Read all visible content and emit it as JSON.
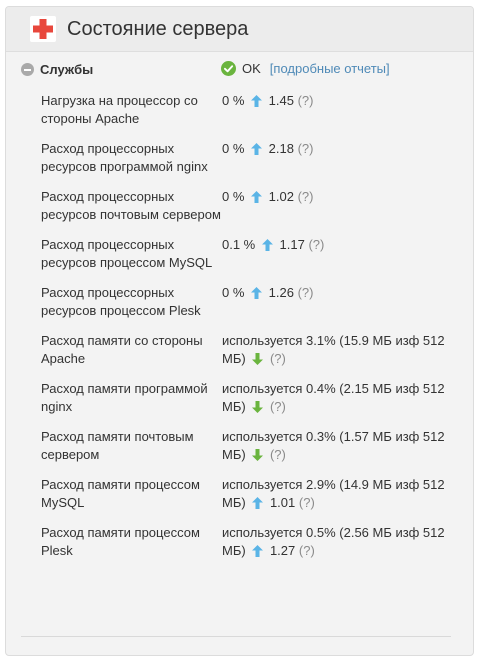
{
  "panel": {
    "title": "Состояние сервера"
  },
  "section": {
    "title": "Службы",
    "status_label": "OK",
    "reports_link": "[подробные отчеты]"
  },
  "rows": [
    {
      "label": "Нагрузка на процессор со стороны Apache",
      "usage": "0 %",
      "trend": "up",
      "value": "1.45",
      "help": "(?)"
    },
    {
      "label": "Расход процессорных ресурсов программой nginx",
      "usage": "0 %",
      "trend": "up",
      "value": "2.18",
      "help": "(?)"
    },
    {
      "label": "Расход процессорных ресурсов почтовым сервером",
      "usage": "0 %",
      "trend": "up",
      "value": "1.02",
      "help": "(?)"
    },
    {
      "label": "Расход процессорных ресурсов процессом MySQL",
      "usage": "0.1 %",
      "trend": "up",
      "value": "1.17",
      "help": "(?)"
    },
    {
      "label": "Расход процессорных ресурсов процессом Plesk",
      "usage": "0 %",
      "trend": "up",
      "value": "1.26",
      "help": "(?)"
    },
    {
      "label": "Расход памяти со стороны Apache",
      "usage": "используется 3.1% (15.9 МБ изф 512 МБ)",
      "trend": "down",
      "value": "",
      "help": "(?)"
    },
    {
      "label": "Расход памяти программой nginx",
      "usage": "используется 0.4% (2.15 МБ изф 512 МБ)",
      "trend": "down",
      "value": "",
      "help": "(?)"
    },
    {
      "label": "Расход памяти почтовым сервером",
      "usage": "используется 0.3% (1.57 МБ изф 512 МБ)",
      "trend": "down",
      "value": "",
      "help": "(?)"
    },
    {
      "label": "Расход памяти процессом MySQL",
      "usage": "используется 2.9% (14.9 МБ изф 512 МБ)",
      "trend": "up",
      "value": "1.01",
      "help": "(?)"
    },
    {
      "label": "Расход памяти процессом Plesk",
      "usage": "используется 0.5% (2.56 МБ изф 512 МБ)",
      "trend": "up",
      "value": "1.27",
      "help": "(?)"
    }
  ],
  "icons": {
    "header": "plus-icon",
    "status": "check-circle-icon",
    "trend_up": "arrow-up-icon",
    "trend_down": "arrow-down-icon",
    "collapse": "collapse-toggle-icon"
  },
  "colors": {
    "accent_red": "#e8473c",
    "ok_green": "#6ab43e",
    "trend_up": "#5ab4e6",
    "trend_down": "#6ab43e",
    "link": "#4f8ab7"
  }
}
